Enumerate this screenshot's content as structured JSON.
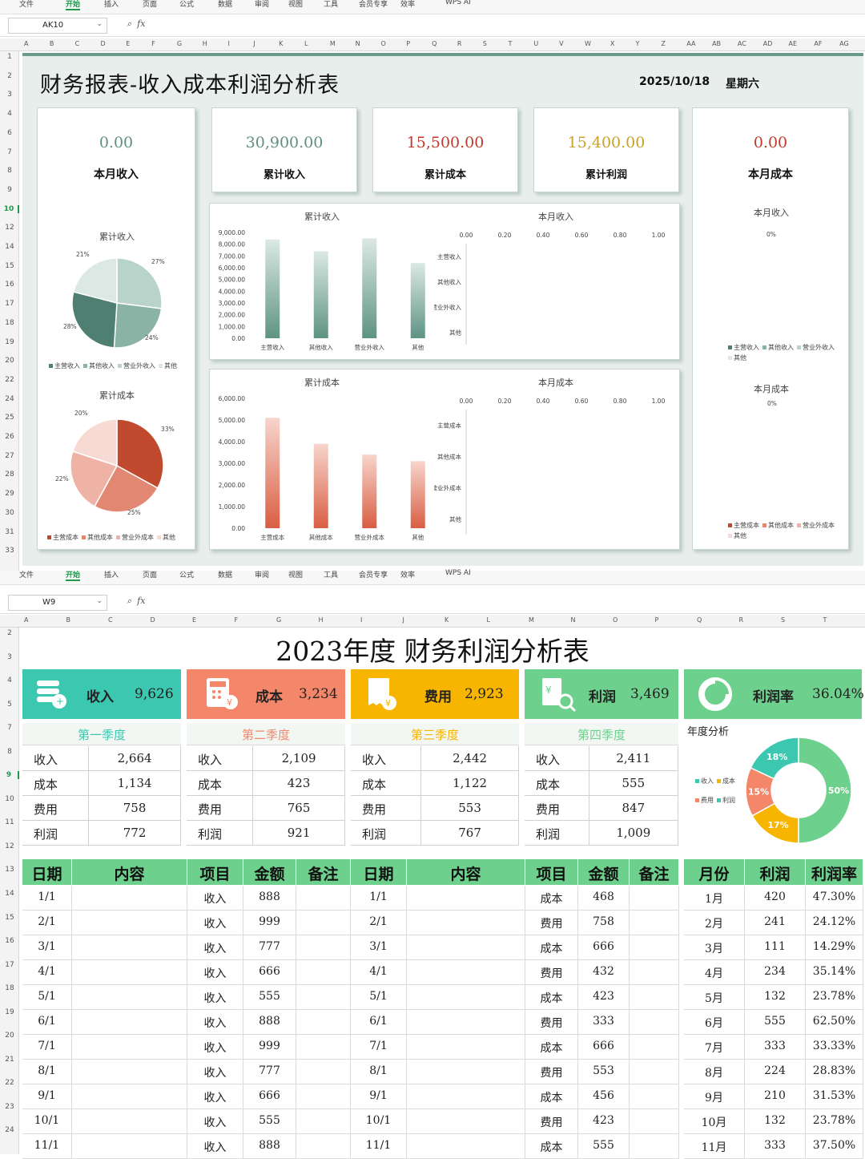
{
  "window1": {
    "menu": [
      "文件",
      "开始",
      "插入",
      "页面",
      "公式",
      "数据",
      "审阅",
      "视图",
      "工具",
      "会员专享",
      "效率",
      "WPS AI"
    ],
    "active_menu": "开始",
    "namebox": "AK10",
    "fx": "fx",
    "columns": [
      "A",
      "B",
      "C",
      "D",
      "E",
      "F",
      "G",
      "H",
      "I",
      "J",
      "K",
      "L",
      "M",
      "N",
      "O",
      "P",
      "Q",
      "R",
      "S",
      "T",
      "U",
      "V",
      "W",
      "X",
      "Y",
      "Z",
      "AA",
      "AB",
      "AC",
      "AD",
      "AE",
      "AF",
      "AG"
    ],
    "rows": [
      "1",
      "2",
      "3",
      "4",
      "6",
      "7",
      "8",
      "9",
      "10",
      "12",
      "14",
      "15",
      "16",
      "17",
      "18",
      "19",
      "20",
      "22",
      "24",
      "25",
      "26",
      "27",
      "28",
      "29",
      "30",
      "31",
      "33"
    ],
    "selected_row": "10"
  },
  "dashboard": {
    "title": "财务报表-收入成本利润分析表",
    "date": "2025/10/18",
    "weekday": "星期六",
    "kpis": [
      {
        "value": "0.00",
        "label": "本月收入",
        "color": "#5f8e82"
      },
      {
        "value": "30,900.00",
        "label": "累计收入",
        "color": "#5f8e82"
      },
      {
        "value": "15,500.00",
        "label": "累计成本",
        "color": "#c0392b"
      },
      {
        "value": "15,400.00",
        "label": "累计利润",
        "color": "#c9a227"
      },
      {
        "value": "0.00",
        "label": "本月成本",
        "color": "#c0392b"
      }
    ],
    "pie_income": {
      "title": "累计收入",
      "labels": [
        "21%",
        "27%",
        "24%",
        "28%"
      ],
      "legend": [
        "主营收入",
        "其他收入",
        "营业外收入",
        "其他"
      ]
    },
    "pie_cost": {
      "title": "累计成本",
      "labels": [
        "20%",
        "33%",
        "25%",
        "22%"
      ],
      "legend": [
        "主营成本",
        "其他成本",
        "营业外成本",
        "其他"
      ]
    },
    "bar_income": {
      "title": "累计收入",
      "yticks": [
        "9,000.00",
        "8,000.00",
        "7,000.00",
        "6,000.00",
        "5,000.00",
        "4,000.00",
        "3,000.00",
        "2,000.00",
        "1,000.00",
        "0.00"
      ],
      "categories": [
        "主营收入",
        "其他收入",
        "营业外收入",
        "其他"
      ]
    },
    "bar_cost": {
      "title": "累计成本",
      "yticks": [
        "6,000.00",
        "5,000.00",
        "4,000.00",
        "3,000.00",
        "2,000.00",
        "1,000.00",
        "0.00"
      ],
      "categories": [
        "主营成本",
        "其他成本",
        "营业外成本",
        "其他"
      ]
    },
    "hbar_income": {
      "title": "本月收入",
      "xticks": [
        "0.00",
        "0.20",
        "0.40",
        "0.60",
        "0.80",
        "1.00"
      ],
      "categories": [
        "主营收入",
        "其他收入",
        "营业外收入",
        "其他"
      ]
    },
    "hbar_cost": {
      "title": "本月成本",
      "xticks": [
        "0.00",
        "0.20",
        "0.40",
        "0.60",
        "0.80",
        "1.00"
      ],
      "categories": [
        "主营成本",
        "其他成本",
        "营业外成本",
        "其他"
      ]
    },
    "side_income": {
      "title": "本月收入",
      "pct": "0%",
      "legend": [
        "主营收入",
        "其他收入",
        "营业外收入",
        "其他"
      ]
    },
    "side_cost": {
      "title": "本月成本",
      "pct": "0%",
      "legend": [
        "主营成本",
        "其他成本",
        "营业外成本",
        "其他"
      ]
    }
  },
  "chart_data": [
    {
      "type": "pie",
      "title": "累计收入",
      "categories": [
        "主营收入",
        "其他收入",
        "营业外收入",
        "其他"
      ],
      "values": [
        27,
        24,
        28,
        21
      ]
    },
    {
      "type": "pie",
      "title": "累计成本",
      "categories": [
        "主营成本",
        "其他成本",
        "营业外成本",
        "其他"
      ],
      "values": [
        33,
        25,
        22,
        20
      ]
    },
    {
      "type": "bar",
      "title": "累计收入",
      "categories": [
        "主营收入",
        "其他收入",
        "营业外收入",
        "其他"
      ],
      "values": [
        8400,
        7400,
        8500,
        6400
      ],
      "ylim": [
        0,
        9000
      ]
    },
    {
      "type": "bar",
      "title": "累计成本",
      "categories": [
        "主营成本",
        "其他成本",
        "营业外成本",
        "其他"
      ],
      "values": [
        5100,
        3900,
        3400,
        3100
      ],
      "ylim": [
        0,
        6000
      ]
    },
    {
      "type": "bar",
      "title": "本月收入",
      "categories": [
        "主营收入",
        "其他收入",
        "营业外收入",
        "其他"
      ],
      "values": [
        0,
        0,
        0,
        0
      ],
      "xlim": [
        0,
        1
      ]
    },
    {
      "type": "bar",
      "title": "本月成本",
      "categories": [
        "主营成本",
        "其他成本",
        "营业外成本",
        "其他"
      ],
      "values": [
        0,
        0,
        0,
        0
      ],
      "xlim": [
        0,
        1
      ]
    },
    {
      "type": "pie",
      "title": "年度分析",
      "categories": [
        "收入",
        "成本",
        "费用",
        "利润"
      ],
      "values": [
        50,
        17,
        15,
        18
      ]
    }
  ],
  "window2": {
    "menu": [
      "文件",
      "开始",
      "插入",
      "页面",
      "公式",
      "数据",
      "审阅",
      "视图",
      "工具",
      "会员专享",
      "效率",
      "WPS AI"
    ],
    "namebox": "W9",
    "fx": "fx",
    "columns": [
      "A",
      "B",
      "C",
      "D",
      "E",
      "F",
      "G",
      "H",
      "I",
      "J",
      "K",
      "L",
      "M",
      "N",
      "O",
      "P",
      "Q",
      "R",
      "S",
      "T"
    ],
    "rows": [
      "2",
      "3",
      "4",
      "5",
      "7",
      "8",
      "9",
      "10",
      "11",
      "12",
      "13",
      "14",
      "15",
      "16",
      "17",
      "18",
      "19",
      "20",
      "21",
      "22",
      "23",
      "24"
    ],
    "selected_row": "9"
  },
  "report": {
    "title": "2023年度 财务利润分析表",
    "kpis": [
      {
        "label": "收入",
        "value": "9,626",
        "color": "#3cc7b0"
      },
      {
        "label": "成本",
        "value": "3,234",
        "color": "#f4876a"
      },
      {
        "label": "费用",
        "value": "2,923",
        "color": "#f7b500"
      },
      {
        "label": "利润",
        "value": "3,469",
        "color": "#6dd08c"
      },
      {
        "label": "利润率",
        "value": "36.04%",
        "color": "#6dd08c"
      }
    ],
    "quarters": [
      {
        "name": "第一季度",
        "color": "#3cc7b0",
        "rows": [
          [
            "收入",
            "2,664"
          ],
          [
            "成本",
            "1,134"
          ],
          [
            "费用",
            "758"
          ],
          [
            "利润",
            "772"
          ]
        ]
      },
      {
        "name": "第二季度",
        "color": "#f4876a",
        "rows": [
          [
            "收入",
            "2,109"
          ],
          [
            "成本",
            "423"
          ],
          [
            "费用",
            "765"
          ],
          [
            "利润",
            "921"
          ]
        ]
      },
      {
        "name": "第三季度",
        "color": "#f7b500",
        "rows": [
          [
            "收入",
            "2,442"
          ],
          [
            "成本",
            "1,122"
          ],
          [
            "费用",
            "553"
          ],
          [
            "利润",
            "767"
          ]
        ]
      },
      {
        "name": "第四季度",
        "color": "#6dd08c",
        "rows": [
          [
            "收入",
            "2,411"
          ],
          [
            "成本",
            "555"
          ],
          [
            "费用",
            "847"
          ],
          [
            "利润",
            "1,009"
          ]
        ]
      }
    ],
    "annual": {
      "title": "年度分析",
      "legend": [
        "收入",
        "成本",
        "费用",
        "利润"
      ],
      "labels": [
        "50%",
        "17%",
        "15%",
        "18%"
      ]
    },
    "headers_left": [
      "日期",
      "内容",
      "项目",
      "金额",
      "备注"
    ],
    "headers_mid": [
      "日期",
      "内容",
      "项目",
      "金额",
      "备注"
    ],
    "headers_right": [
      "月份",
      "利润",
      "利润率"
    ],
    "left_rows": [
      [
        "1/1",
        "",
        "收入",
        "888",
        ""
      ],
      [
        "2/1",
        "",
        "收入",
        "999",
        ""
      ],
      [
        "3/1",
        "",
        "收入",
        "777",
        ""
      ],
      [
        "4/1",
        "",
        "收入",
        "666",
        ""
      ],
      [
        "5/1",
        "",
        "收入",
        "555",
        ""
      ],
      [
        "6/1",
        "",
        "收入",
        "888",
        ""
      ],
      [
        "7/1",
        "",
        "收入",
        "999",
        ""
      ],
      [
        "8/1",
        "",
        "收入",
        "777",
        ""
      ],
      [
        "9/1",
        "",
        "收入",
        "666",
        ""
      ],
      [
        "10/1",
        "",
        "收入",
        "555",
        ""
      ],
      [
        "11/1",
        "",
        "收入",
        "888",
        ""
      ]
    ],
    "mid_rows": [
      [
        "1/1",
        "",
        "成本",
        "468",
        ""
      ],
      [
        "2/1",
        "",
        "费用",
        "758",
        ""
      ],
      [
        "3/1",
        "",
        "成本",
        "666",
        ""
      ],
      [
        "4/1",
        "",
        "费用",
        "432",
        ""
      ],
      [
        "5/1",
        "",
        "成本",
        "423",
        ""
      ],
      [
        "6/1",
        "",
        "费用",
        "333",
        ""
      ],
      [
        "7/1",
        "",
        "成本",
        "666",
        ""
      ],
      [
        "8/1",
        "",
        "费用",
        "553",
        ""
      ],
      [
        "9/1",
        "",
        "成本",
        "456",
        ""
      ],
      [
        "10/1",
        "",
        "费用",
        "423",
        ""
      ],
      [
        "11/1",
        "",
        "成本",
        "555",
        ""
      ]
    ],
    "right_rows": [
      [
        "1月",
        "420",
        "47.30%"
      ],
      [
        "2月",
        "241",
        "24.12%"
      ],
      [
        "3月",
        "111",
        "14.29%"
      ],
      [
        "4月",
        "234",
        "35.14%"
      ],
      [
        "5月",
        "132",
        "23.78%"
      ],
      [
        "6月",
        "555",
        "62.50%"
      ],
      [
        "7月",
        "333",
        "33.33%"
      ],
      [
        "8月",
        "224",
        "28.83%"
      ],
      [
        "9月",
        "210",
        "31.53%"
      ],
      [
        "10月",
        "132",
        "23.78%"
      ],
      [
        "11月",
        "333",
        "37.50%"
      ]
    ]
  }
}
